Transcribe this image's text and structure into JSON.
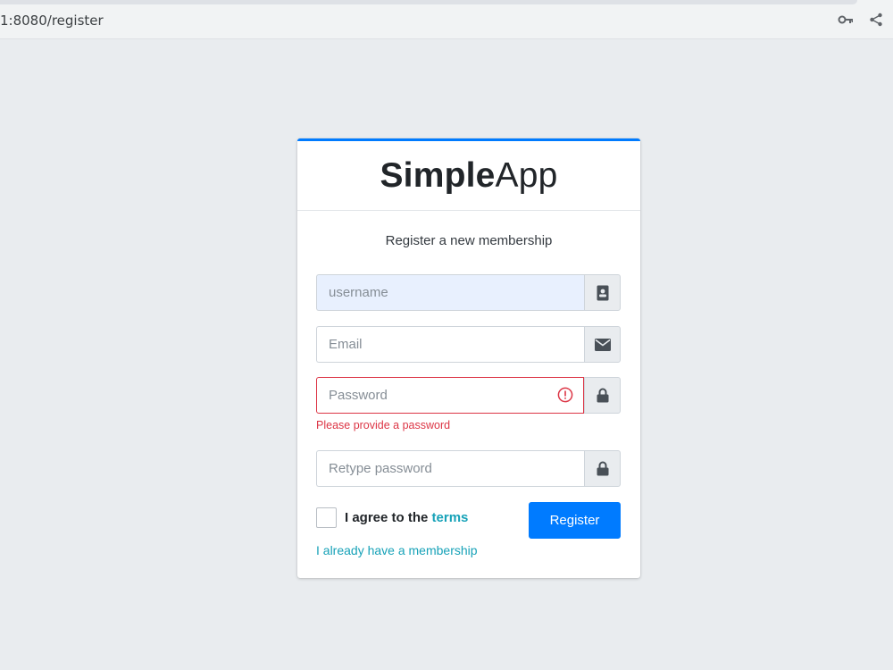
{
  "browser": {
    "url": "1:8080/register",
    "icons": [
      "key-icon",
      "share-icon"
    ]
  },
  "brand": {
    "bold": "Simple",
    "light": "App",
    "accent": "#007bff"
  },
  "form": {
    "message": "Register a new membership",
    "username_placeholder": "username",
    "email_placeholder": "Email",
    "password_placeholder": "Password",
    "password_error": "Please provide a password",
    "retype_placeholder": "Retype password",
    "agree_text": "I agree to the ",
    "terms_link": "terms",
    "register_button": "Register",
    "member_link": "I already have a membership"
  },
  "colors": {
    "primary": "#007bff",
    "danger": "#dc3545",
    "info": "#17a2b8"
  }
}
